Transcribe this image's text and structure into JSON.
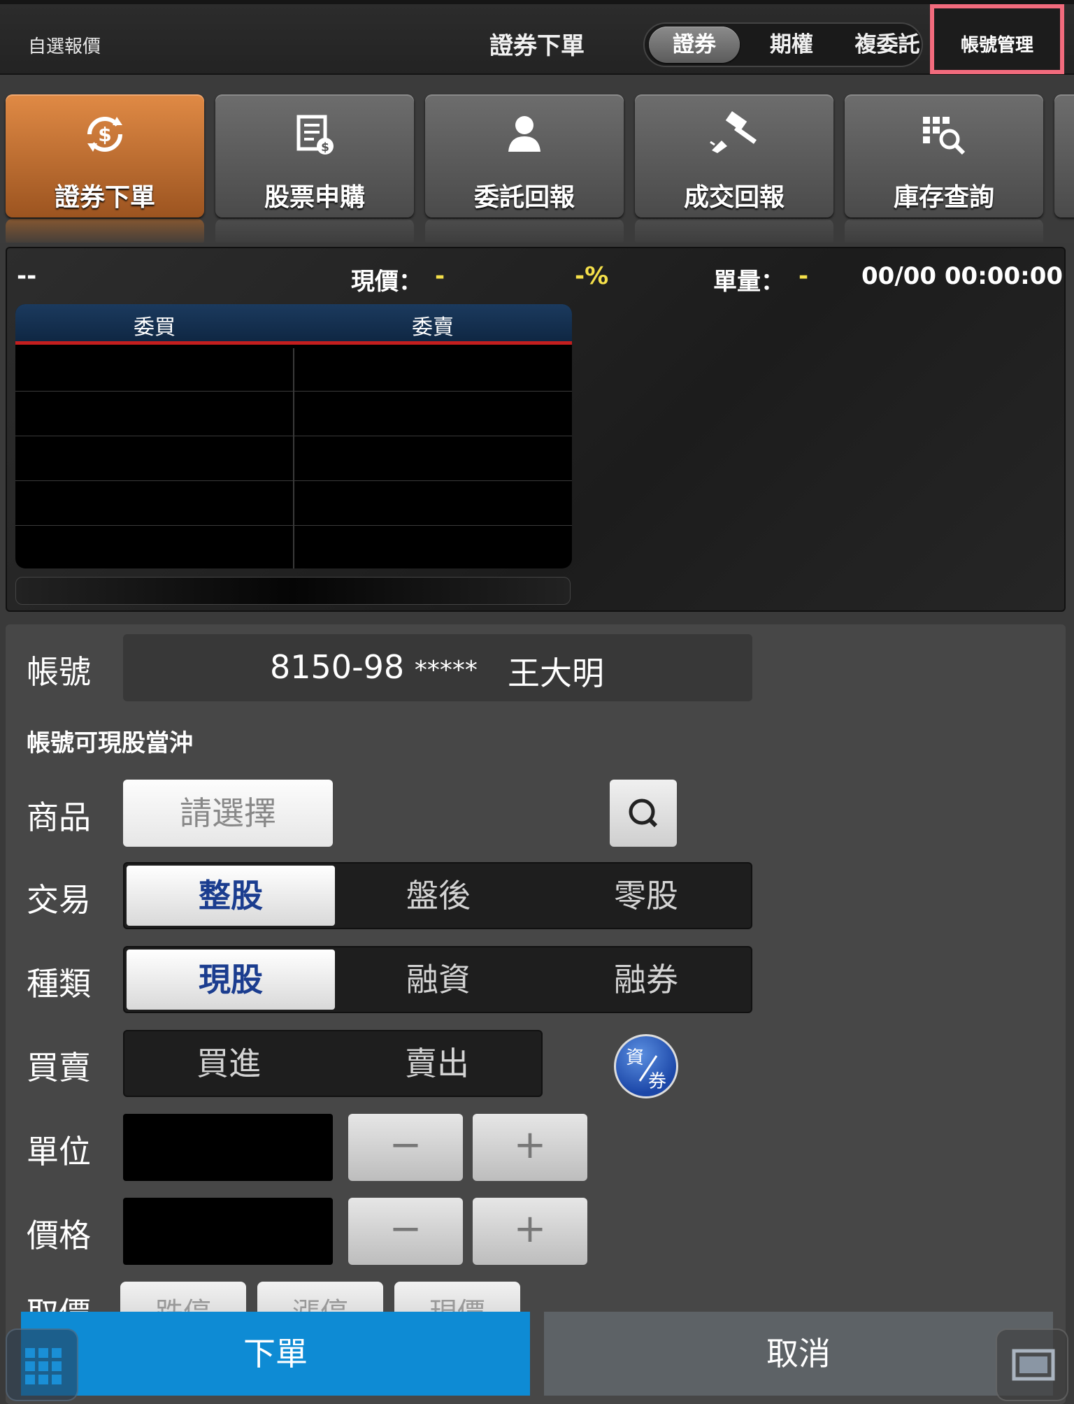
{
  "topbar": {
    "watchlist": "自選報價",
    "title": "證券下單",
    "segments": [
      "證券",
      "期權",
      "複委託"
    ],
    "account_manage": "帳號管理"
  },
  "tiles": [
    {
      "label": "證券下單",
      "icon": "dollar-cycle-icon",
      "active": true
    },
    {
      "label": "股票申購",
      "icon": "document-dollar-icon",
      "active": false
    },
    {
      "label": "委託回報",
      "icon": "person-icon",
      "active": false
    },
    {
      "label": "成交回報",
      "icon": "gavel-icon",
      "active": false
    },
    {
      "label": "庫存查詢",
      "icon": "grid-search-icon",
      "active": false
    }
  ],
  "quote": {
    "symbol": "--",
    "price_label": "現價：",
    "price": "-",
    "change_pct": "-%",
    "volume_label": "單量：",
    "volume": "-",
    "datetime": "00/00 00:00:00",
    "book_headers": [
      "委買",
      "委賣"
    ]
  },
  "form": {
    "account_label": "帳號",
    "account_number": "8150-98",
    "account_mask": "*****",
    "account_name": "王大明",
    "note": "帳號可現股當沖",
    "product_label": "商品",
    "product_placeholder": "請選擇",
    "trade_label": "交易",
    "trade_options": [
      "整股",
      "盤後",
      "零股"
    ],
    "type_label": "種類",
    "type_options": [
      "現股",
      "融資",
      "融券"
    ],
    "side_label": "買賣",
    "side_options": [
      "買進",
      "賣出"
    ],
    "credit_icon_text": [
      "資",
      "券"
    ],
    "unit_label": "單位",
    "price_label": "價格",
    "minus": "−",
    "plus": "+",
    "quick_label": "取價",
    "quick_options": [
      "跌停",
      "漲停",
      "現價"
    ]
  },
  "actions": {
    "submit": "下單",
    "cancel": "取消"
  }
}
